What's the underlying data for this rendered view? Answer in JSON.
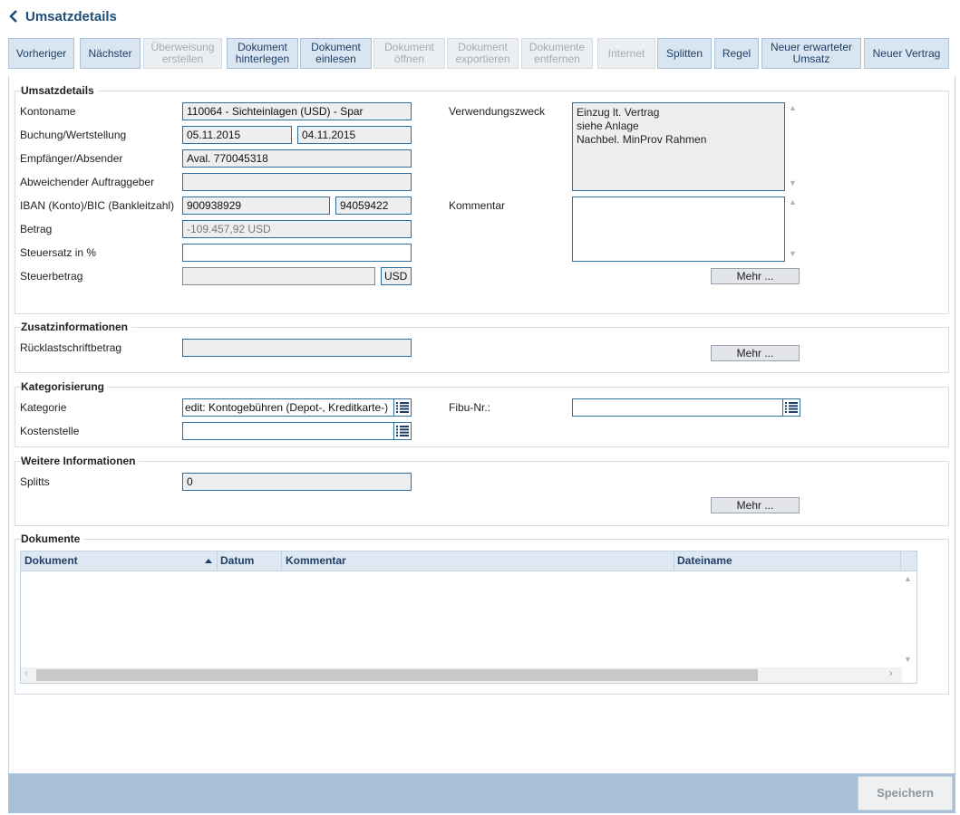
{
  "header": {
    "title": "Umsatzdetails"
  },
  "toolbar": [
    {
      "label": "Vorheriger",
      "enabled": true
    },
    {
      "label": "Nächster",
      "enabled": true
    },
    {
      "label": "Überweisung\nerstellen",
      "enabled": false
    },
    {
      "label": "Dokument\nhinterlegen",
      "enabled": true
    },
    {
      "label": "Dokument\neinlesen",
      "enabled": true
    },
    {
      "label": "Dokument\nöffnen",
      "enabled": false
    },
    {
      "label": "Dokument\nexportieren",
      "enabled": false
    },
    {
      "label": "Dokumente\nentfernen",
      "enabled": false
    },
    {
      "label": "Internet",
      "enabled": false
    },
    {
      "label": "Splitten",
      "enabled": true
    },
    {
      "label": "Regel",
      "enabled": true
    },
    {
      "label": "Neuer erwarteter\nUmsatz",
      "enabled": true
    },
    {
      "label": "Neuer Vertrag",
      "enabled": true
    }
  ],
  "umsatzdetails": {
    "title": "Umsatzdetails",
    "kontoname_label": "Kontoname",
    "kontoname_value": "110064 - Sichteinlagen (USD) - Spar",
    "buchung_label": "Buchung/Wertstellung",
    "buchung_value": "05.11.2015",
    "wertstellung_value": "04.11.2015",
    "empfaenger_label": "Empfänger/Absender",
    "empfaenger_value": "Aval. 770045318",
    "abweichender_label": "Abweichender Auftraggeber",
    "abweichender_value": "",
    "iban_label": "IBAN (Konto)/BIC (Bankleitzahl)",
    "iban_value": "900938929",
    "bic_value": "94059422",
    "betrag_label": "Betrag",
    "betrag_value": "-109.457,92 USD",
    "steuersatz_label": "Steuersatz in %",
    "steuersatz_value": "",
    "steuerbetrag_label": "Steuerbetrag",
    "steuerbetrag_value": "",
    "currency": "USD",
    "verwendungszweck_label": "Verwendungszweck",
    "verwendungszweck_value": "Einzug lt. Vertrag\nsiehe Anlage\nNachbel. MinProv Rahmen",
    "kommentar_label": "Kommentar",
    "kommentar_value": "",
    "mehr_label": "Mehr ..."
  },
  "zusatz": {
    "title": "Zusatzinformationen",
    "ruecklast_label": "Rücklastschriftbetrag",
    "ruecklast_value": "",
    "mehr_label": "Mehr ..."
  },
  "kategorisierung": {
    "title": "Kategorisierung",
    "kategorie_label": "Kategorie",
    "kategorie_value": "edit: Kontogebühren (Depot-, Kreditkarte-)",
    "fibu_label": "Fibu-Nr.:",
    "fibu_value": "",
    "kostenstelle_label": "Kostenstelle",
    "kostenstelle_value": ""
  },
  "weitere": {
    "title": "Weitere Informationen",
    "splitts_label": "Splitts",
    "splitts_value": "0",
    "mehr_label": "Mehr ..."
  },
  "dokumente": {
    "title": "Dokumente",
    "columns": [
      "Dokument",
      "Datum",
      "Kommentar",
      "Dateiname"
    ],
    "rows": []
  },
  "footer": {
    "save_label": "Speichern"
  },
  "colors": {
    "accent": "#1f4e79",
    "field_border": "#2e6f9e",
    "toolbar_bg": "#d9e5f1",
    "footer_bg": "#a9c0d9"
  }
}
